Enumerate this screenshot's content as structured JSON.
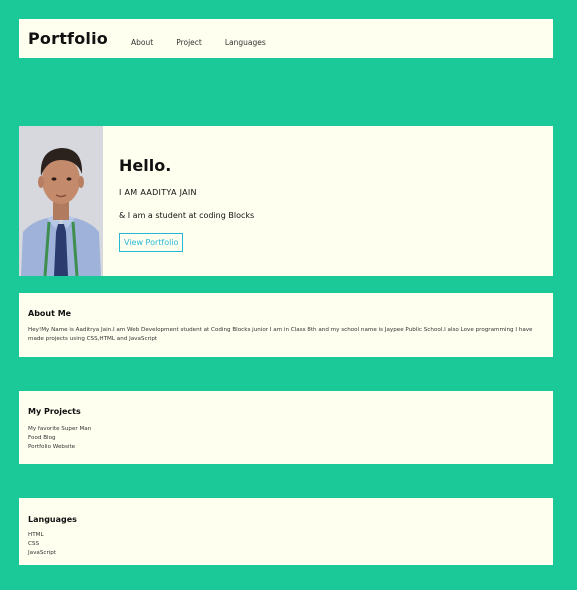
{
  "nav": {
    "logo": "Portfolio",
    "links": [
      "About",
      "Project",
      "Languages"
    ]
  },
  "hero": {
    "greeting": "Hello.",
    "name": "I AM AADITYA JAIN",
    "tagline": "& I am a student at coding Blocks",
    "button_label": "View Portfolio"
  },
  "about": {
    "heading": "About Me",
    "text": "Hey!My Name is Aaditrya Jain.I am Web Development student at Coding Blocks junior I am in Class 8th and my school name is Jaypee Public School.I also Love programming  I have made projects using CSS,HTML and JavaScript"
  },
  "projects": {
    "heading": "My Projects",
    "items": [
      "My favorite Super Man",
      "Food Blog",
      "Portfolio Website"
    ]
  },
  "languages": {
    "heading": "Languages",
    "items": [
      "HTML",
      "CSS",
      "JavaScript"
    ]
  },
  "colors": {
    "background": "#1bc998",
    "panel": "#fffff0",
    "button_accent": "#26b8d6"
  }
}
